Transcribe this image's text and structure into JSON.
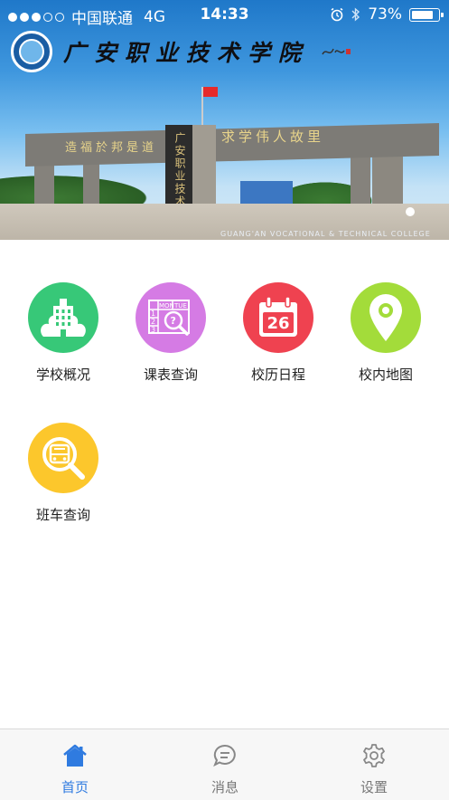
{
  "status_bar": {
    "carrier": "中国联通",
    "network": "4G",
    "time": "14:33",
    "battery": "73%",
    "battery_level": 0.73,
    "signal_bars_filled": 3,
    "signal_bars_total": 5
  },
  "banner": {
    "college_name": "广安职业技术学院",
    "beam_text_left": "造福於邦是道",
    "beam_text_right": "求学伟人故里",
    "pillar_text": "广安职业技术学院",
    "caption": "GUANG'AN VOCATIONAL & TECHNICAL COLLEGE",
    "page_indicator_count": 1
  },
  "grid": {
    "items": [
      {
        "label": "学校概况",
        "icon": "school-building-icon",
        "color": "#37c878"
      },
      {
        "label": "课表查询",
        "icon": "timetable-search-icon",
        "color": "#d57be4",
        "icon_text_1": "MON",
        "icon_text_2": "TUE",
        "icon_rows": [
          "1",
          "2",
          "3"
        ]
      },
      {
        "label": "校历日程",
        "icon": "calendar-icon",
        "color": "#ef4250",
        "icon_text": "26"
      },
      {
        "label": "校内地图",
        "icon": "map-pin-icon",
        "color": "#a3dc3a"
      },
      {
        "label": "班车查询",
        "icon": "bus-search-icon",
        "color": "#fcc72c"
      }
    ]
  },
  "tab_bar": {
    "items": [
      {
        "label": "首页",
        "icon": "home-icon",
        "active": true
      },
      {
        "label": "消息",
        "icon": "chat-bubble-icon",
        "active": false
      },
      {
        "label": "设置",
        "icon": "gear-icon",
        "active": false
      }
    ],
    "active_color": "#2f7be0",
    "inactive_color": "#777777"
  }
}
